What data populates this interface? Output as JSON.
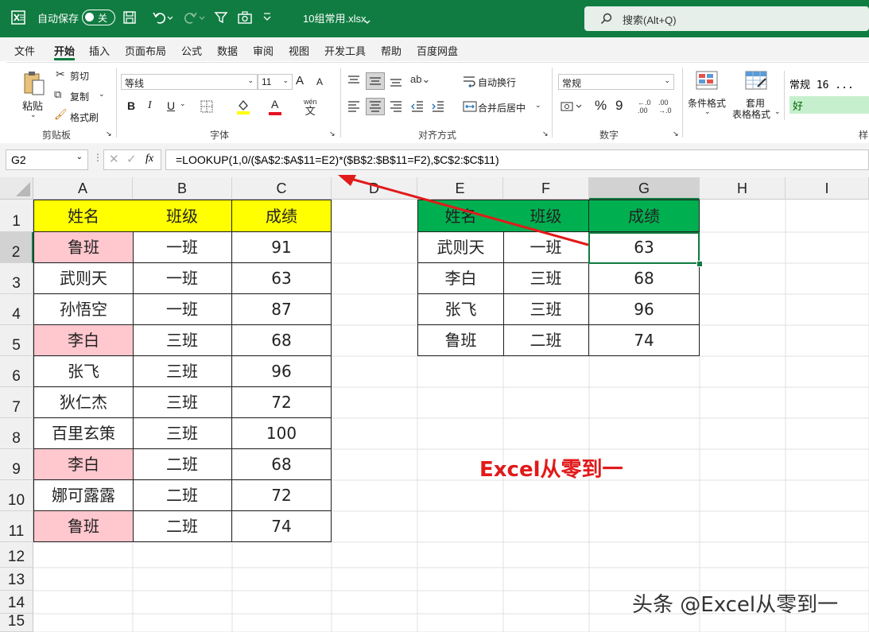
{
  "titlebar": {
    "autosave_label": "自动保存",
    "autosave_state": "关",
    "filename": "10组常用.xlsx",
    "search_placeholder": "搜索(Alt+Q)"
  },
  "menu": [
    "文件",
    "开始",
    "插入",
    "页面布局",
    "公式",
    "数据",
    "审阅",
    "视图",
    "开发工具",
    "帮助",
    "百度网盘"
  ],
  "ribbon": {
    "clipboard": {
      "paste": "粘贴",
      "cut": "剪切",
      "copy": "复制",
      "format_painter": "格式刷",
      "label": "剪贴板"
    },
    "font": {
      "name": "等线",
      "size": "11",
      "label": "字体",
      "bold": "B",
      "italic": "I",
      "underline": "U",
      "increase": "A",
      "decrease": "A",
      "color": "A",
      "wen": "wén",
      "wen_char": "文"
    },
    "alignment": {
      "wrap": "自动换行",
      "merge": "合并后居中",
      "label": "对齐方式"
    },
    "number": {
      "format": "常规",
      "percent": "%",
      "comma": "9",
      "label": "数字"
    },
    "styles": {
      "cond_format": "条件格式",
      "table_format_1": "套用",
      "table_format_2": "表格格式",
      "style_normal": "常规 16 ...",
      "style_good": "好",
      "style_partial": "样"
    }
  },
  "formula_bar": {
    "name_box": "G2",
    "fx": "fx",
    "formula": "=LOOKUP(1,0/($A$2:$A$11=E2)*($B$2:$B$11=F2),$C$2:$C$11)"
  },
  "columns": [
    "A",
    "B",
    "C",
    "D",
    "E",
    "F",
    "G",
    "H",
    "I"
  ],
  "rows": [
    "1",
    "2",
    "3",
    "4",
    "5",
    "6",
    "7",
    "8",
    "9",
    "10",
    "11",
    "12",
    "13",
    "14",
    "15"
  ],
  "source_table": {
    "headers": [
      "姓名",
      "班级",
      "成绩"
    ],
    "rows": [
      [
        "鲁班",
        "一班",
        "91"
      ],
      [
        "武则天",
        "一班",
        "63"
      ],
      [
        "孙悟空",
        "一班",
        "87"
      ],
      [
        "李白",
        "三班",
        "68"
      ],
      [
        "张飞",
        "三班",
        "96"
      ],
      [
        "狄仁杰",
        "三班",
        "72"
      ],
      [
        "百里玄策",
        "三班",
        "100"
      ],
      [
        "李白",
        "二班",
        "68"
      ],
      [
        "娜可露露",
        "二班",
        "72"
      ],
      [
        "鲁班",
        "二班",
        "74"
      ]
    ]
  },
  "lookup_table": {
    "headers": [
      "姓名",
      "班级",
      "成绩"
    ],
    "rows": [
      [
        "武则天",
        "一班",
        "63"
      ],
      [
        "李白",
        "三班",
        "68"
      ],
      [
        "张飞",
        "三班",
        "96"
      ],
      [
        "鲁班",
        "二班",
        "74"
      ]
    ]
  },
  "annotation": "Excel从零到一",
  "watermark": "头条 @Excel从零到一",
  "colors": {
    "excel_green": "#107c41",
    "header_yellow": "#ffff00",
    "header_green": "#00b050",
    "duplicate_pink": "#ffc7ce",
    "arrow_red": "#e11a1a"
  }
}
